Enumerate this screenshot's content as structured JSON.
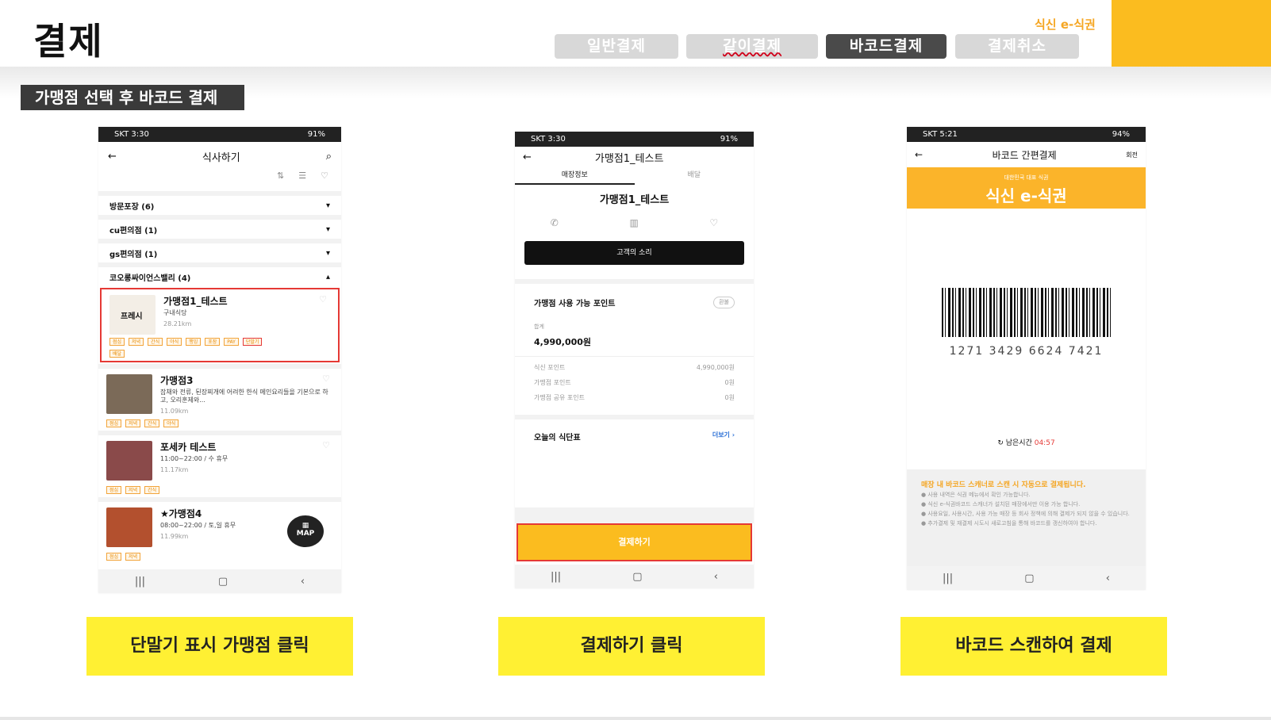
{
  "page": {
    "title": "결제",
    "brand": "식신 e-식권",
    "tabs": [
      {
        "label": "일반결제"
      },
      {
        "label": "같이결제"
      },
      {
        "label": "바코드결제"
      },
      {
        "label": "결제취소"
      }
    ],
    "section_label": "가맹점 선택 후 바코드 결제"
  },
  "phone1": {
    "status": "SKT 3:30",
    "status_right": "91%",
    "title": "식사하기",
    "categories": [
      {
        "label": "방문포장 (6)",
        "arrow": "▾"
      },
      {
        "label": "cu편의점 (1)",
        "arrow": "▾"
      },
      {
        "label": "gs편의점 (1)",
        "arrow": "▾"
      },
      {
        "label": "코오롱싸이언스밸리 (4)",
        "arrow": "▴"
      }
    ],
    "stores": [
      {
        "name": "가맹점1_테스트",
        "desc": "구내식당",
        "dist": "28.21km",
        "thumb_text": "프레시"
      },
      {
        "name": "가맹점3",
        "desc": "잡채와 전류, 된장찌개에 어려한 한식 메인요리들을 기본으로 하고, 오리훈제와...",
        "dist": "11.09km"
      },
      {
        "name": "포세카 테스트",
        "desc": "11:00~22:00 / 수 휴무",
        "dist": "11.17km"
      },
      {
        "name": "★가맹점4",
        "desc": "08:00~22:00 / 토,일 휴무",
        "dist": "11.99km"
      }
    ],
    "tags1": [
      "점심",
      "저녁",
      "간식",
      "야식",
      "행잉",
      "포장",
      "PAY",
      "단말기",
      "배달"
    ],
    "tags2": [
      "점심",
      "저녁",
      "간식",
      "야식"
    ],
    "tags3": [
      "점심",
      "저녁",
      "간식"
    ],
    "tags4": [
      "점심",
      "저녁"
    ],
    "map_label": "MAP"
  },
  "phone2": {
    "status": "SKT 3:30",
    "status_right": "91%",
    "title": "가맹점1_테스트",
    "tab_info": "매장정보",
    "tab_delivery": "배달",
    "store_name": "가맹점1_테스트",
    "voice_btn": "고객의 소리",
    "points_title": "가맹점 사용 가능 포인트",
    "points_badge": "환불",
    "total_label": "합계",
    "total_value": "4,990,000원",
    "rows": [
      {
        "label": "식신 포인트",
        "value": "4,990,000원"
      },
      {
        "label": "가맹점 포인트",
        "value": "0원"
      },
      {
        "label": "가맹점 공유 포인트",
        "value": "0원"
      }
    ],
    "menu_title": "오늘의 식단표",
    "menu_more": "더보기  ›",
    "pay_btn": "결제하기"
  },
  "phone3": {
    "status": "SKT 5:21",
    "status_right": "94%",
    "title": "바코드 간편결제",
    "head_right": "회전",
    "banner_sub": "대한민국 대표 식권",
    "banner_big": "식신 e-식권",
    "barcode_number": "1271  3429  6624  7421",
    "remain_label": "남은시간",
    "remain_time": "04:57",
    "notice_head": "매장 내 바코드 스캐너로 스캔 시 자동으로 결제됩니다.",
    "notice_lines": [
      "● 사용 내역은 식권 메뉴에서 확인 가능합니다.",
      "● 식신 e-식권바코드 스캐너가 설치된 매장에서만 이용 가능 합니다.",
      "● 사용요일, 사용시간, 사용 가능 매장 등 회사 정책에 의해 결제가 되지 않을 수 있습니다.",
      "● 추가결제 및 재결제 시도시 새로고침을 통해 바코드를 갱신하여야 합니다."
    ]
  },
  "captions": [
    "단말기 표시 가맹점 클릭",
    "결제하기 클릭",
    "바코드 스캔하여 결제"
  ],
  "colors": {
    "accent": "#fbbc1f",
    "caption": "#fff033",
    "highlight": "#e53935"
  }
}
